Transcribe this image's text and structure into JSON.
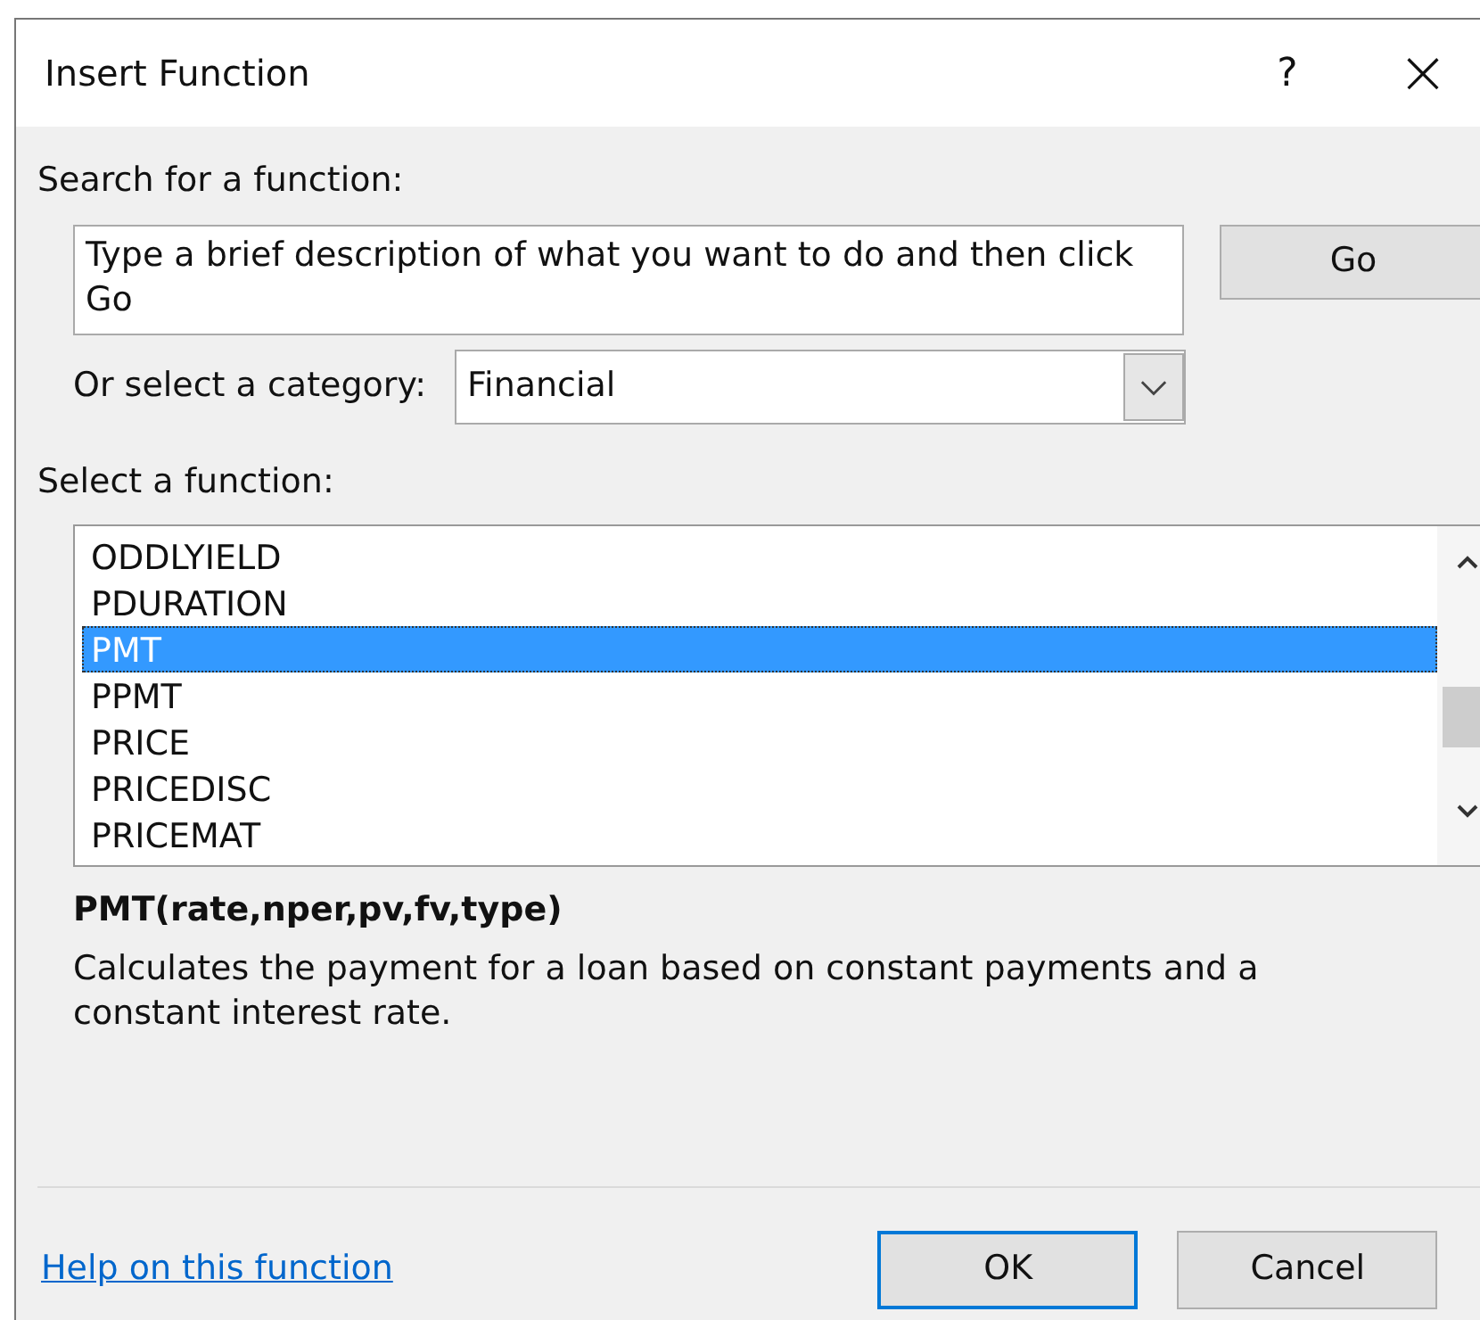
{
  "window": {
    "title": "Insert Function",
    "help": "?",
    "close": "×"
  },
  "search": {
    "label": "Search for a function:",
    "value": "Type a brief description of what you want to do and then click Go",
    "go_button": "Go"
  },
  "category": {
    "label": "Or select a category:",
    "value": "Financial"
  },
  "functions": {
    "label": "Select a function:",
    "items": [
      {
        "name": "ODDLYIELD",
        "selected": false
      },
      {
        "name": "PDURATION",
        "selected": false
      },
      {
        "name": "PMT",
        "selected": true
      },
      {
        "name": "PPMT",
        "selected": false
      },
      {
        "name": "PRICE",
        "selected": false
      },
      {
        "name": "PRICEDISC",
        "selected": false
      },
      {
        "name": "PRICEMAT",
        "selected": false
      }
    ]
  },
  "signature": "PMT(rate,nper,pv,fv,type)",
  "description": "Calculates the payment for a loan based on constant payments and a constant interest rate.",
  "help_link": "Help on this function",
  "buttons": [
    {
      "label": "OK",
      "default": true
    },
    {
      "label": "Cancel",
      "default": false
    }
  ]
}
